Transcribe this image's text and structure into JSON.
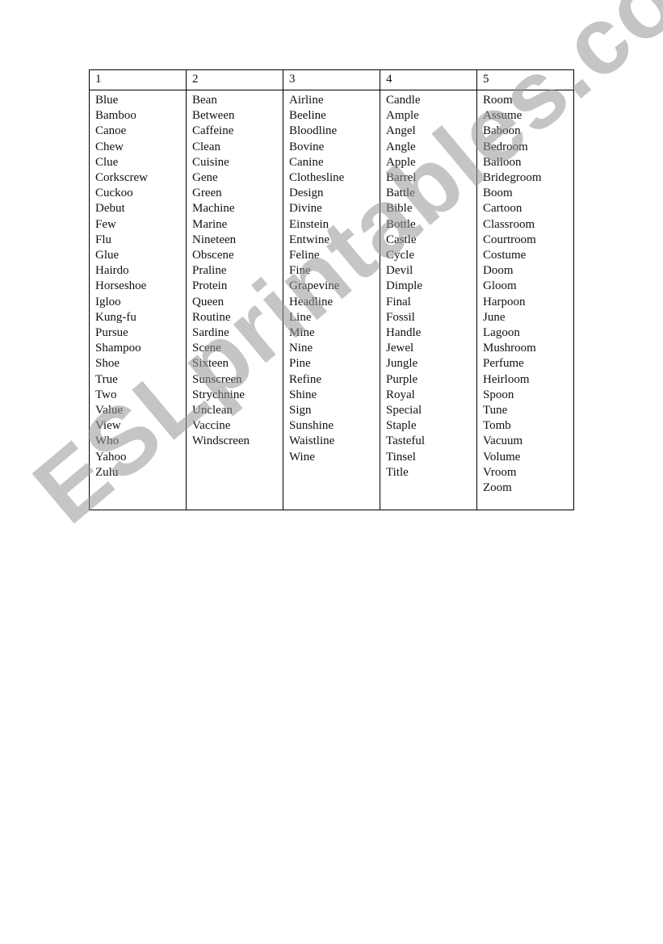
{
  "table": {
    "headers": [
      "1",
      "2",
      "3",
      "4",
      "5"
    ],
    "columns": [
      [
        "Blue",
        "Bamboo",
        "Canoe",
        "Chew",
        "Clue",
        "Corkscrew",
        "Cuckoo",
        "Debut",
        "Few",
        "Flu",
        "Glue",
        "Hairdo",
        "Horseshoe",
        "Igloo",
        "Kung-fu",
        "Pursue",
        "Shampoo",
        "Shoe",
        "True",
        "Two",
        "Value",
        "View",
        "Who",
        "Yahoo",
        "Zulu"
      ],
      [
        "Bean",
        "Between",
        "Caffeine",
        "Clean",
        "Cuisine",
        "Gene",
        "Green",
        "Machine",
        "Marine",
        "Nineteen",
        "Obscene",
        "Praline",
        "Protein",
        "Queen",
        "Routine",
        "Sardine",
        "Scene",
        "Sixteen",
        "Sunscreen",
        "Strychnine",
        "Unclean",
        "Vaccine",
        "Windscreen"
      ],
      [
        "Airline",
        "Beeline",
        "Bloodline",
        "Bovine",
        "Canine",
        "Clothesline",
        "Design",
        "Divine",
        "Einstein",
        "Entwine",
        "Feline",
        "Fine",
        "Grapevine",
        "Headline",
        "Line",
        "Mine",
        "Nine",
        "Pine",
        "Refine",
        "Shine",
        "Sign",
        "Sunshine",
        "Waistline",
        "Wine"
      ],
      [
        "Candle",
        "Ample",
        "Angel",
        "Angle",
        "Apple",
        "Barrel",
        "Battle",
        "Bible",
        "Bottle",
        "Castle",
        "Cycle",
        "Devil",
        "Dimple",
        "Final",
        "Fossil",
        "Handle",
        "Jewel",
        "Jungle",
        "Purple",
        "Royal",
        "Special",
        "Staple",
        "Tasteful",
        "Tinsel",
        "Title"
      ],
      [
        "Room",
        "Assume",
        "Baboon",
        "Bedroom",
        "Balloon",
        "Bridegroom",
        "Boom",
        "Cartoon",
        "Classroom",
        "Courtroom",
        "Costume",
        "Doom",
        "Gloom",
        "Harpoon",
        "June",
        "Lagoon",
        "Mushroom",
        "Perfume",
        "Heirloom",
        "Spoon",
        "Tune",
        "Tomb",
        "Vacuum",
        "Volume",
        "Vroom",
        "Zoom"
      ]
    ]
  },
  "watermark": {
    "text": "ESLprintables.com"
  }
}
